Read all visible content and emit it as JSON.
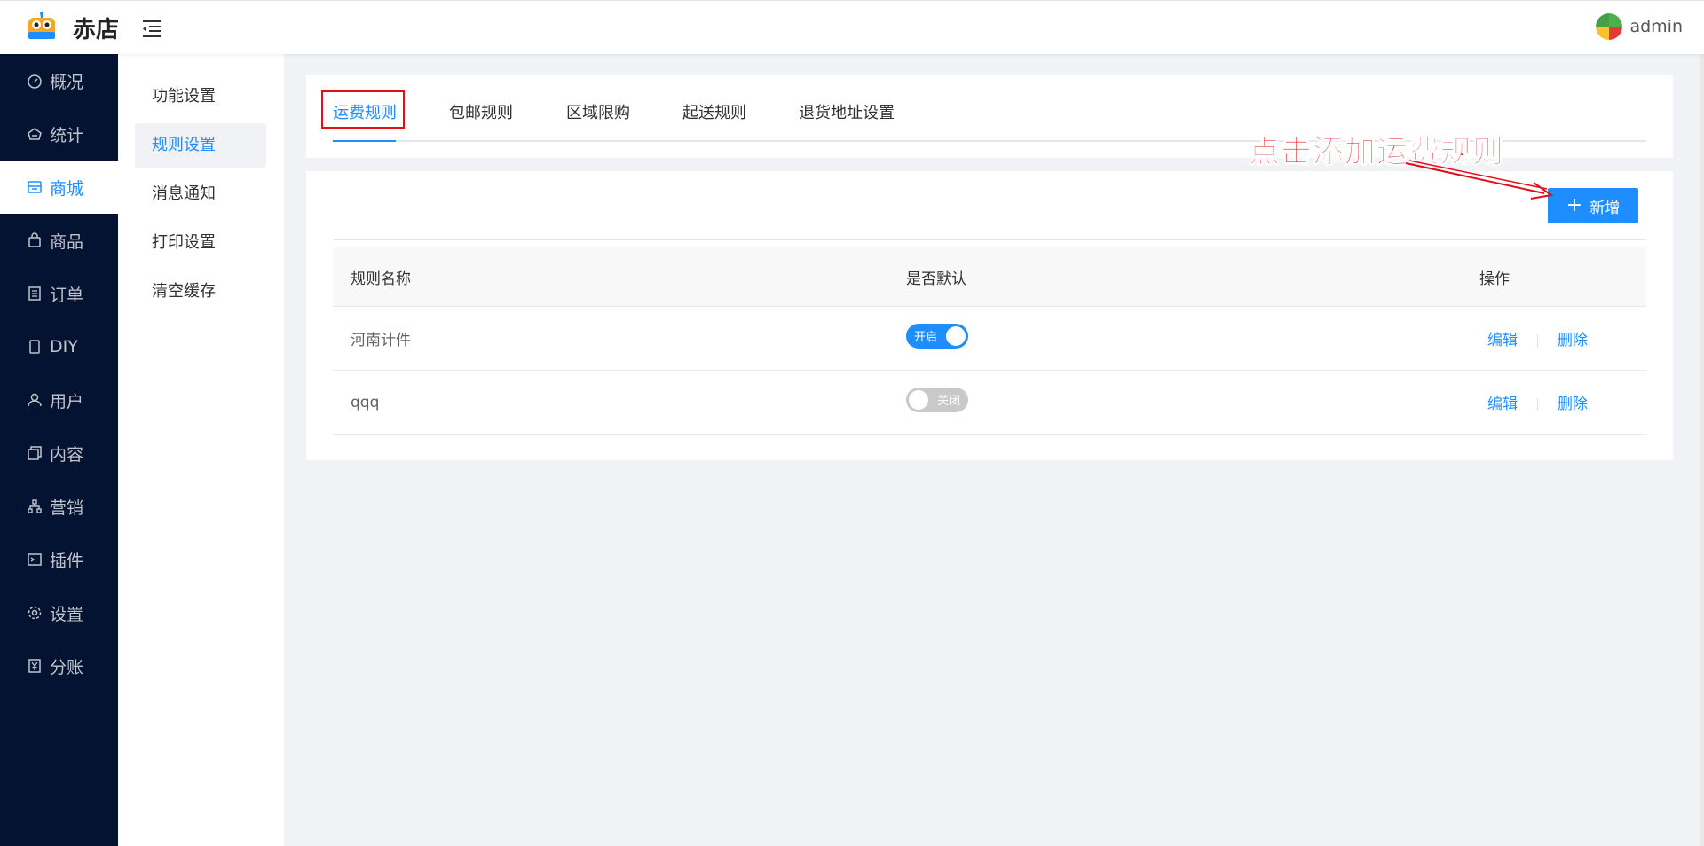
{
  "header": {
    "brand": "赤店",
    "user": "admin"
  },
  "nav": {
    "items": [
      {
        "label": "概况",
        "icon": "dashboard-icon"
      },
      {
        "label": "统计",
        "icon": "statistics-icon"
      },
      {
        "label": "商城",
        "icon": "store-icon",
        "active": true
      },
      {
        "label": "商品",
        "icon": "shopping-bag-icon"
      },
      {
        "label": "订单",
        "icon": "order-list-icon"
      },
      {
        "label": "DIY",
        "icon": "mobile-page-icon"
      },
      {
        "label": "用户",
        "icon": "user-icon"
      },
      {
        "label": "内容",
        "icon": "content-icon"
      },
      {
        "label": "营销",
        "icon": "marketing-icon"
      },
      {
        "label": "插件",
        "icon": "plugin-icon"
      },
      {
        "label": "设置",
        "icon": "gear-icon"
      },
      {
        "label": "分账",
        "icon": "split-account-icon"
      }
    ]
  },
  "subnav": {
    "items": [
      {
        "label": "功能设置"
      },
      {
        "label": "规则设置",
        "active": true
      },
      {
        "label": "消息通知"
      },
      {
        "label": "打印设置"
      },
      {
        "label": "清空缓存"
      }
    ]
  },
  "tabs": [
    {
      "label": "运费规则",
      "active": true
    },
    {
      "label": "包邮规则"
    },
    {
      "label": "区域限购"
    },
    {
      "label": "起送规则"
    },
    {
      "label": "退货地址设置"
    }
  ],
  "toolbar": {
    "add_label": "新增"
  },
  "table": {
    "headers": {
      "name": "规则名称",
      "default": "是否默认",
      "ops": "操作"
    },
    "rows": [
      {
        "name": "河南计件",
        "default_on": true,
        "switch_text": "开启",
        "edit": "编辑",
        "delete": "删除"
      },
      {
        "name": "qqq",
        "default_on": false,
        "switch_text": "关闭",
        "edit": "编辑",
        "delete": "删除"
      }
    ]
  },
  "annotation": {
    "text": "点击添加运费规则"
  },
  "colors": {
    "primary": "#1e8eff",
    "nav_bg": "#041331",
    "annotation_red": "#e0101b",
    "page_bg": "#f0f2f5"
  }
}
